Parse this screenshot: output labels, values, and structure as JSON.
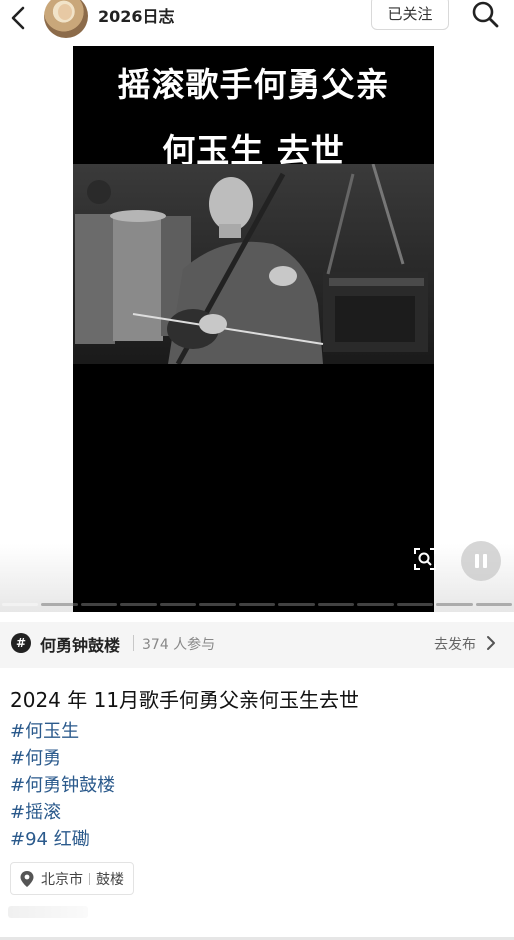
{
  "header": {
    "account_name": "2026日志",
    "follow_label": "已关注"
  },
  "video": {
    "overlay_line1": "摇滚歌手何勇父亲",
    "overlay_line2": "何玉生 去世",
    "progress_segments": 13,
    "progress_active_index": 0
  },
  "topic": {
    "icon_glyph": "#",
    "name": "何勇钟鼓楼",
    "participants": "374 人参与",
    "publish_label": "去发布"
  },
  "post": {
    "title": "2024 年 11月歌手何勇父亲何玉生去世",
    "hashtags": [
      "#何玉生",
      "#何勇",
      "#何勇钟鼓楼",
      "#摇滚",
      "#94 红磡"
    ]
  },
  "location": {
    "city": "北京市",
    "place": "鼓楼"
  },
  "colors": {
    "hashtag": "#2b5a8c",
    "topic_bar_bg": "#f5f5f5",
    "video_bg": "#000000"
  },
  "icons": [
    "back-icon",
    "search-icon",
    "scan-icon",
    "pause-icon",
    "topic-icon",
    "chevron-right-icon",
    "location-pin-icon"
  ]
}
